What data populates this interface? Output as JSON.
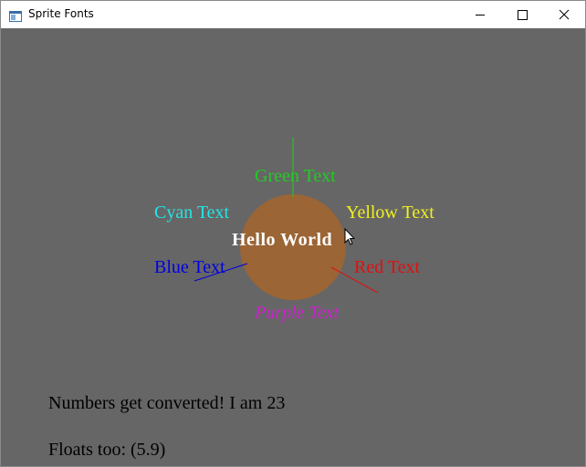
{
  "window": {
    "title": "Sprite Fonts",
    "icon": "app-window-icon",
    "controls": [
      "minimize-icon",
      "maximize-icon",
      "close-icon"
    ]
  },
  "scene": {
    "background_color": "#666666",
    "disc_color": "#9b6535",
    "center_label": {
      "text": "Hello World",
      "color": "#ffffff"
    },
    "labels": {
      "green": {
        "text": "Green Text",
        "color": "#22cc22"
      },
      "cyan": {
        "text": "Cyan Text",
        "color": "#22e6e6"
      },
      "yellow": {
        "text": "Yellow Text",
        "color": "#f0f020"
      },
      "blue": {
        "text": "Blue Text",
        "color": "#0000e0"
      },
      "red": {
        "text": "Red Text",
        "color": "#e01010"
      },
      "purple": {
        "text": "Purple Text",
        "color": "#d020d0"
      }
    },
    "numbers_line": "Numbers get converted! I am 23",
    "floats_line": "Floats too: (5.9)"
  }
}
